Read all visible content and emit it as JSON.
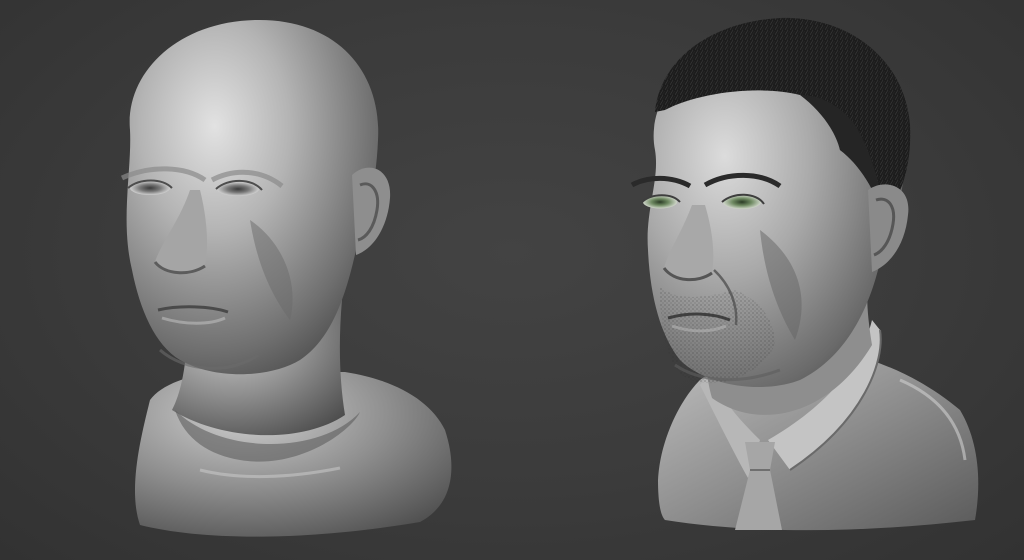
{
  "scene": {
    "background_color": "#3c3c3c",
    "objects": [
      {
        "name": "sculpt-bust-bald",
        "material": "clay",
        "color": "#a9a9a9"
      },
      {
        "name": "sculpt-bust-detailed",
        "material": "clay",
        "color": "#a3a3a3",
        "hair": "short-dark",
        "eye_color": "#6f8a62"
      }
    ]
  }
}
